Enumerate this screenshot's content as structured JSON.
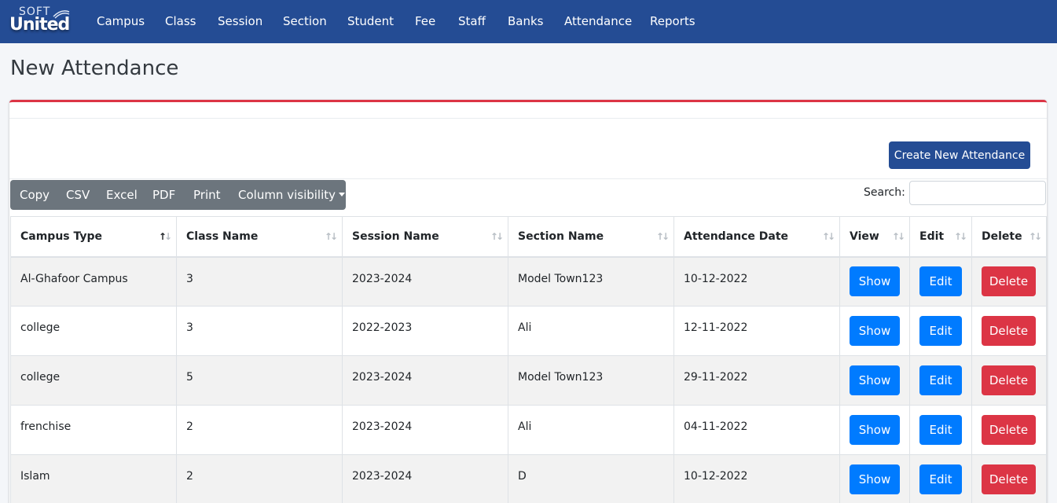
{
  "brand": {
    "soft": "SOFT",
    "united": "United"
  },
  "nav": [
    "Campus",
    "Class",
    "Session",
    "Section",
    "Student",
    "Fee",
    "Staff",
    "Banks",
    "Attendance",
    "Reports"
  ],
  "page": {
    "title": "New Attendance",
    "create_button": "Create New Attendance"
  },
  "toolbar": {
    "copy": "Copy",
    "csv": "CSV",
    "excel": "Excel",
    "pdf": "PDF",
    "print": "Print",
    "column_visibility": "Column visibility"
  },
  "search": {
    "label": "Search:",
    "value": ""
  },
  "table": {
    "columns": [
      "Campus Type",
      "Class Name",
      "Session Name",
      "Section Name",
      "Attendance Date",
      "View",
      "Edit",
      "Delete"
    ],
    "sorted_column": "Campus Type",
    "sort_direction": "ascending",
    "action_labels": {
      "show": "Show",
      "edit": "Edit",
      "delete": "Delete"
    },
    "rows": [
      [
        "Al-Ghafoor Campus",
        "3",
        "2023-2024",
        "Model Town123",
        "10-12-2022"
      ],
      [
        "college",
        "3",
        "2022-2023",
        "Ali",
        "12-11-2022"
      ],
      [
        "college",
        "5",
        "2023-2024",
        "Model Town123",
        "29-11-2022"
      ],
      [
        "frenchise",
        "2",
        "2023-2024",
        "Ali",
        "04-11-2022"
      ],
      [
        "Islam",
        "2",
        "2023-2024",
        "D",
        "10-12-2022"
      ]
    ]
  },
  "colors": {
    "navbar": "#244c94",
    "primary": "#007bff",
    "danger": "#dc3545",
    "secondary": "#6c757d"
  }
}
